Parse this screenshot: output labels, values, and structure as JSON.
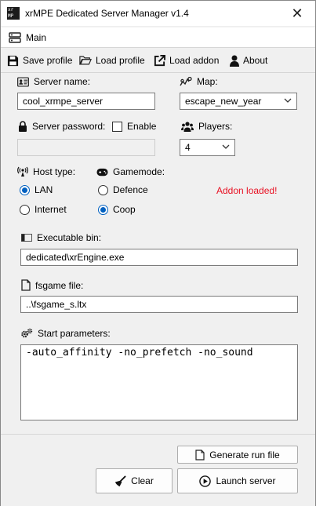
{
  "window": {
    "title": "xrMPE Dedicated Server Manager v1.4",
    "icon_text": "xr\nMP",
    "close_glyph": "✕"
  },
  "menubar": {
    "main_label": "Main"
  },
  "toolbar": {
    "save_label": "Save profile",
    "load_label": "Load profile",
    "addon_label": "Load addon",
    "about_label": "About"
  },
  "form": {
    "server_name_label": "Server name:",
    "server_name_value": "cool_xrmpe_server",
    "map_label": "Map:",
    "map_value": "escape_new_year",
    "password_label": "Server password:",
    "enable_label": "Enable",
    "password_value": "",
    "players_label": "Players:",
    "players_value": "4",
    "host_type_label": "Host type:",
    "host_options": [
      {
        "label": "LAN",
        "selected": true
      },
      {
        "label": "Internet",
        "selected": false
      }
    ],
    "gamemode_label": "Gamemode:",
    "gamemode_options": [
      {
        "label": "Defence",
        "selected": false
      },
      {
        "label": "Coop",
        "selected": true
      }
    ],
    "status_text": "Addon loaded!",
    "exe_label": "Executable bin:",
    "exe_value": "dedicated\\xrEngine.exe",
    "fsgame_label": "fsgame file:",
    "fsgame_value": "..\\fsgame_s.ltx",
    "params_label": "Start parameters:",
    "params_value": "-auto_affinity -no_prefetch -no_sound"
  },
  "buttons": {
    "generate_label": "Generate run file",
    "clear_label": "Clear",
    "launch_label": "Launch server"
  },
  "colors": {
    "status": "#e81123",
    "radio_accent": "#0060c0"
  }
}
